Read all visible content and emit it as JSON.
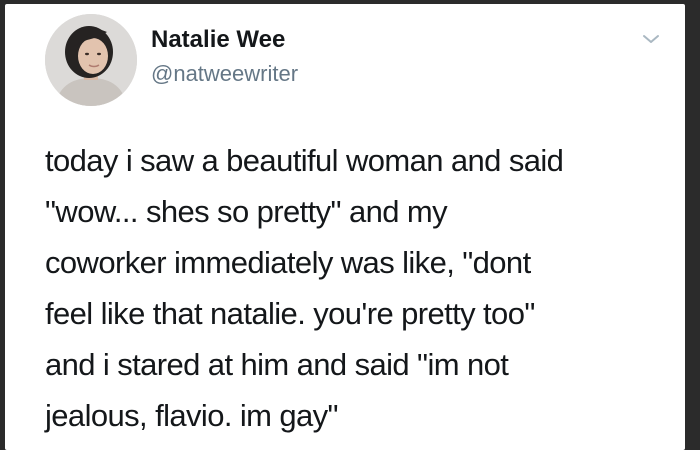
{
  "tweet": {
    "author": {
      "display_name": "Natalie Wee",
      "handle": "@natweewriter",
      "avatar_icon": "profile-photo"
    },
    "menu_icon": "chevron-down-icon",
    "text_lines": [
      "today i saw a beautiful woman and said",
      "\"wow... shes so pretty\" and my",
      "coworker immediately was like, \"dont",
      "feel like that natalie. you're pretty too\"",
      "and i stared at him and said \"im not",
      "jealous, flavio. im gay\""
    ]
  },
  "colors": {
    "background_frame": "#2b2b2b",
    "card": "#ffffff",
    "text_primary": "#14171a",
    "text_secondary": "#657786",
    "chevron": "#aab8c2"
  }
}
